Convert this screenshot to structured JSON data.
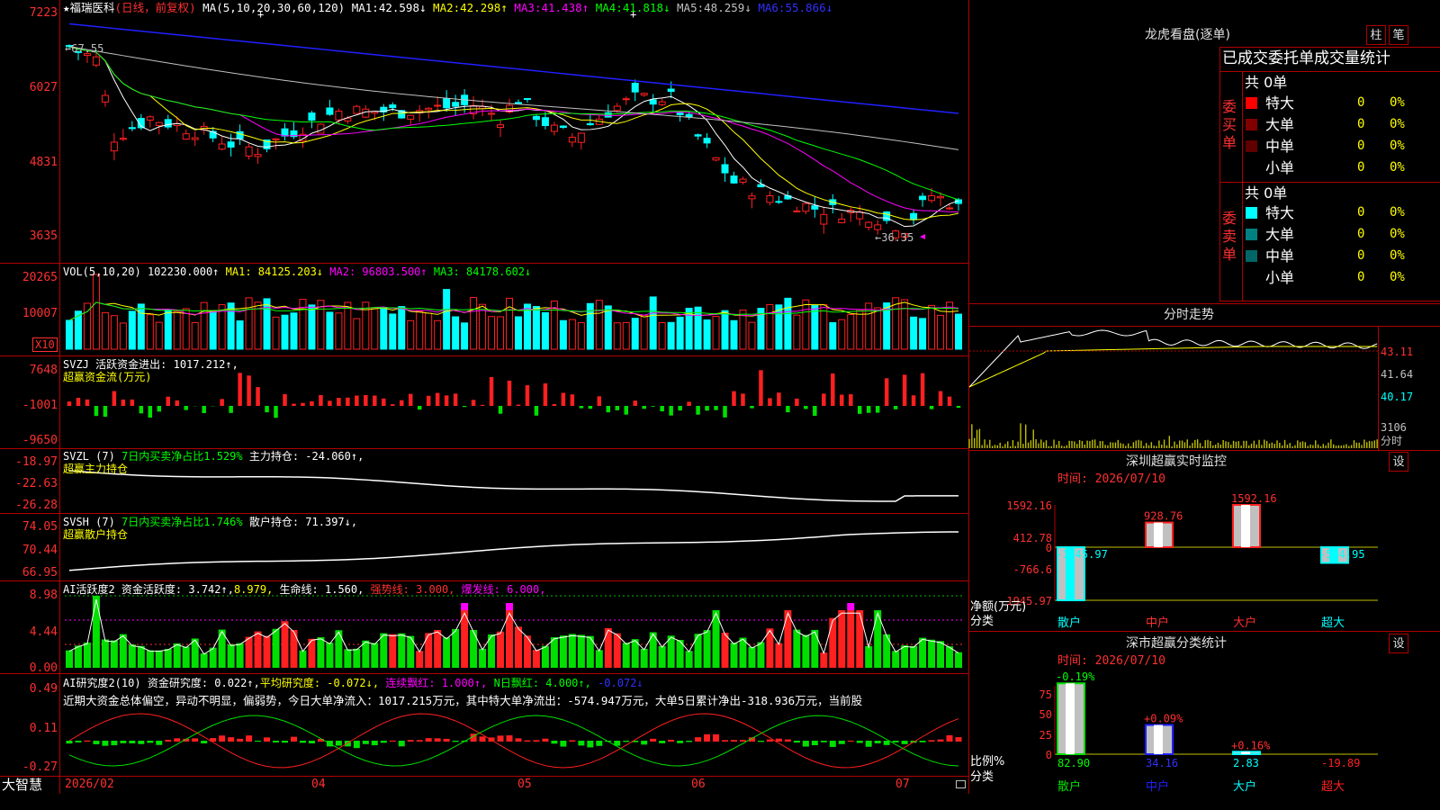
{
  "colors": {
    "up": "#ff2020",
    "down": "#00ffff",
    "green": "#00e000",
    "grid": "#b00000",
    "yellow": "#ffff00",
    "magenta": "#ff00ff",
    "blue": "#2020ff",
    "white": "#ffffff"
  },
  "main": {
    "stock_name": "福瑞医科",
    "period": "(日线，前复权)",
    "ma_head": "MA(5,10,20,30,60,120)",
    "ma": [
      {
        "label": "MA1:",
        "value": "42.598↓"
      },
      {
        "label": "MA2:",
        "value": "42.298↑"
      },
      {
        "label": "MA3:",
        "value": "41.438↑"
      },
      {
        "label": "MA4:",
        "value": "41.818↓"
      },
      {
        "label": "MA5:",
        "value": "48.259↓"
      },
      {
        "label": "MA6:",
        "value": "55.866↓"
      }
    ],
    "y_labels": [
      "7223",
      "6027",
      "4831",
      "3635"
    ],
    "high_mark": "←67.55",
    "low_mark": "←36.35"
  },
  "vol": {
    "title": "VOL(5,10,20)",
    "value": "102230.000↑",
    "ma1": "MA1: 84125.203↓",
    "ma2": "MA2: 96803.500↑",
    "ma3": "MA3: 84178.602↓",
    "y_labels": [
      "20265",
      "10007"
    ],
    "unit": "X10"
  },
  "svzj": {
    "title": "SVZJ",
    "label": "活跃资金进出: 1017.212↑,",
    "sub": "超赢资金流(万元)",
    "y_labels": [
      "7648",
      "-1001",
      "-9650"
    ]
  },
  "svzl": {
    "title": "SVZL (7)",
    "p1": "7日内买卖净占比1.529%",
    "p2": "主力持仓: -24.060↑,",
    "sub": "超赢主力持仓",
    "y_labels": [
      "-18.97",
      "-22.63",
      "-26.28"
    ]
  },
  "svsh": {
    "title": "SVSH (7)",
    "p1": "7日内买卖净占比1.746%",
    "p2": "散户持仓: 71.397↓,",
    "sub": "超赢散户持仓",
    "y_labels": [
      "74.05",
      "70.44",
      "66.95"
    ]
  },
  "ai_act": {
    "title": "AI活跃度2",
    "p1": "资金活跃度: 3.742↑,",
    "p2": "8.979,",
    "p3": "生命线: 1.560,",
    "p4": "强势线: 3.000,",
    "p5": "爆发线: 6.000,",
    "y_labels": [
      "8.98",
      "4.44",
      "0.00"
    ]
  },
  "ai_res": {
    "title": "AI研究度2(10)",
    "p1": "资金研究度: 0.022↑,",
    "p2": "平均研究度: -0.072↓,",
    "p3": "连续飘红: 1.000↑,",
    "p4": "N日飘红: 4.000↑,",
    "p5": "-0.072↓",
    "comment": "近期大资金总体偏空，异动不明显，偏弱势，今日大单净流入：1017.215万元，其中特大单净流出：-574.947万元，大单5日累计净出-318.936万元，当前股",
    "y_labels": [
      "0.49",
      "0.11",
      "-0.27"
    ]
  },
  "x_axis": {
    "brand": "大智慧",
    "labels": [
      "2026/02",
      "04",
      "05",
      "06",
      "07"
    ]
  },
  "right": {
    "dragon_title": "龙虎看盘(逐单)",
    "btn_zhu": "柱",
    "btn_bi": "笔",
    "header": "已成交委托单成交量统计",
    "buy_label": "委买单",
    "sell_label": "委卖单",
    "buy_total": "共 0单",
    "sell_total": "共 0单",
    "buy_rows": [
      {
        "name": "特大",
        "count": "0",
        "pct": "0%"
      },
      {
        "name": "大单",
        "count": "0",
        "pct": "0%"
      },
      {
        "name": "中单",
        "count": "0",
        "pct": "0%"
      },
      {
        "name": "小单",
        "count": "0",
        "pct": "0%"
      }
    ],
    "sell_rows": [
      {
        "name": "特大",
        "count": "0",
        "pct": "0%"
      },
      {
        "name": "大单",
        "count": "0",
        "pct": "0%"
      },
      {
        "name": "中单",
        "count": "0",
        "pct": "0%"
      },
      {
        "name": "小单",
        "count": "0",
        "pct": "0%"
      }
    ],
    "intraday_title": "分时走势",
    "intraday_y": [
      "43.11",
      "41.64",
      "40.17",
      "3106"
    ],
    "intraday_unit": "分时",
    "sz_title": "深圳超赢实时监控",
    "sz_set": "设",
    "sz_time": "时间: 2026/07/10",
    "sz_y": [
      "1592.16",
      "412.78",
      "0",
      "-766.6",
      "-1945.97"
    ],
    "sz_unit": "净额(万元)",
    "sz_cat_label": "分类",
    "sz_bars": [
      {
        "name": "散户",
        "value": -1945.97,
        "label": "-1945.97"
      },
      {
        "name": "中户",
        "value": 928.76,
        "label": "928.76"
      },
      {
        "name": "大户",
        "value": 1592.16,
        "label": "1592.16"
      },
      {
        "name": "超大",
        "value": -574.95,
        "label": "-574.95"
      }
    ],
    "cls_title": "深市超赢分类统计",
    "cls_set": "设",
    "cls_time": "时间: 2026/07/10",
    "cls_y": [
      "75",
      "50",
      "25",
      "0"
    ],
    "cls_unit": "比例%",
    "cls_cat_label": "分类",
    "cls_bars": [
      {
        "name": "散户",
        "value": 82.9,
        "label": "82.90",
        "change": "-0.19%"
      },
      {
        "name": "中户",
        "value": 34.16,
        "label": "34.16",
        "change": "+0.09%"
      },
      {
        "name": "大户",
        "value": 2.83,
        "label": "2.83",
        "change": "+0.16%"
      },
      {
        "name": "超大",
        "value": -19.89,
        "label": "-19.89",
        "change": ""
      }
    ]
  }
}
